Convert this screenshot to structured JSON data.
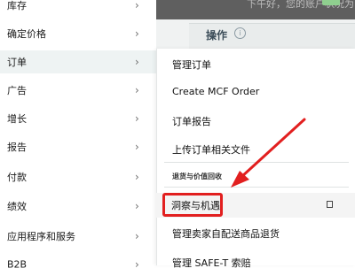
{
  "left_menu": {
    "items": [
      {
        "label": "库存"
      },
      {
        "label": "确定价格"
      },
      {
        "label": "订单"
      },
      {
        "label": "广告"
      },
      {
        "label": "增长"
      },
      {
        "label": "报告"
      },
      {
        "label": "付款"
      },
      {
        "label": "绩效"
      },
      {
        "label": "应用程序和服务"
      },
      {
        "label": "B2B"
      }
    ],
    "chevron": "›"
  },
  "background": {
    "top_note": "下午好，您的账户状况为",
    "action_card_title": "操作",
    "info_icon_glyph": "i"
  },
  "submenu": {
    "items": [
      {
        "label": "管理订单"
      },
      {
        "label": "Create MCF Order"
      },
      {
        "label": "订单报告"
      },
      {
        "label": "上传订单相关文件"
      }
    ],
    "section_header": "退货与价值回收",
    "section_items": [
      {
        "label": "洞察与机遇"
      },
      {
        "label": "管理卖家自配送商品退货"
      },
      {
        "label": "管理 SAFE-T 索赔"
      }
    ]
  },
  "annotation": {
    "arrow_color": "#e21f1f",
    "highlight_color": "#e21f1f"
  }
}
